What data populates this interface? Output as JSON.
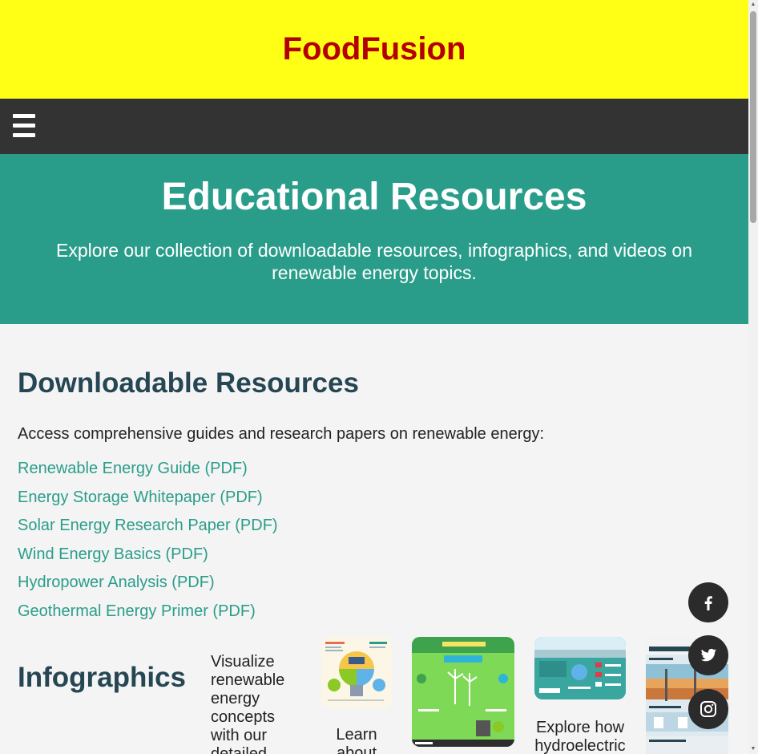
{
  "header": {
    "brand": "FoodFusion"
  },
  "nav": {
    "menu_icon": "hamburger-menu-icon"
  },
  "hero": {
    "title": "Educational Resources",
    "subtitle": "Explore our collection of downloadable resources, infographics, and videos on renewable energy topics."
  },
  "downloads": {
    "title": "Downloadable Resources",
    "intro": "Access comprehensive guides and research papers on renewable energy:",
    "links": [
      "Renewable Energy Guide (PDF)",
      "Energy Storage Whitepaper (PDF)",
      "Solar Energy Research Paper (PDF)",
      "Wind Energy Basics (PDF)",
      "Hydropower Analysis (PDF)",
      "Geothermal Energy Primer (PDF)"
    ]
  },
  "infographics": {
    "title": "Infographics",
    "description": "Visualize renewable energy concepts with our detailed",
    "items": [
      {
        "caption": "Learn about"
      },
      {
        "caption": ""
      },
      {
        "caption": "Explore how hydroelectric"
      },
      {
        "caption": ""
      }
    ]
  },
  "social": {
    "icons": [
      "facebook-icon",
      "twitter-icon",
      "instagram-icon"
    ]
  },
  "colors": {
    "header_bg": "#ffff16",
    "brand": "#b30000",
    "nav_bg": "#333333",
    "hero_bg": "#2a9d8a",
    "link": "#2a9d8a",
    "heading": "#264653"
  }
}
